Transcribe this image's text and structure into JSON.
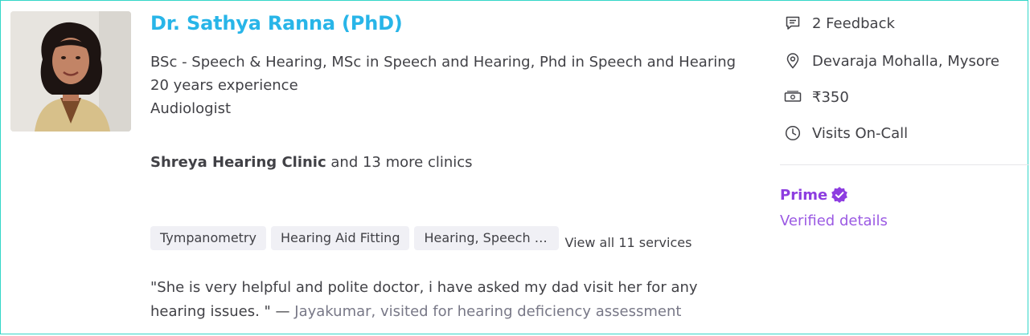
{
  "doctor": {
    "name": "Dr. Sathya Ranna (PhD)",
    "qualifications": "BSc - Speech & Hearing, MSc in Speech and Hearing, Phd in Speech and Hearing",
    "experience": "20 years experience",
    "specialty": "Audiologist"
  },
  "clinic": {
    "name": "Shreya Hearing Clinic",
    "more": "and 13 more clinics"
  },
  "services": {
    "tags": [
      "Tympanometry",
      "Hearing Aid Fitting",
      "Hearing, Speech and Language Assessment"
    ],
    "view_all": "View all 11 services"
  },
  "review": {
    "quote": "\"She is very helpful and polite doctor, i have asked my dad visit her for any hearing issues. \" — ",
    "reviewer": "Jayakumar, visited for hearing deficiency assessment"
  },
  "sidebar": {
    "feedback": "2 Feedback",
    "location": "Devaraja Mohalla, Mysore",
    "fee": "₹350",
    "visits": "Visits On-Call"
  },
  "prime": {
    "label": "Prime",
    "verified": "Verified details"
  },
  "colors": {
    "name": "#28b5e8",
    "prime": "#8d3de0",
    "border": "#33d6c8"
  },
  "icons": [
    "chat-bubble-icon",
    "location-pin-icon",
    "cash-icon",
    "clock-icon",
    "verified-check-icon"
  ]
}
